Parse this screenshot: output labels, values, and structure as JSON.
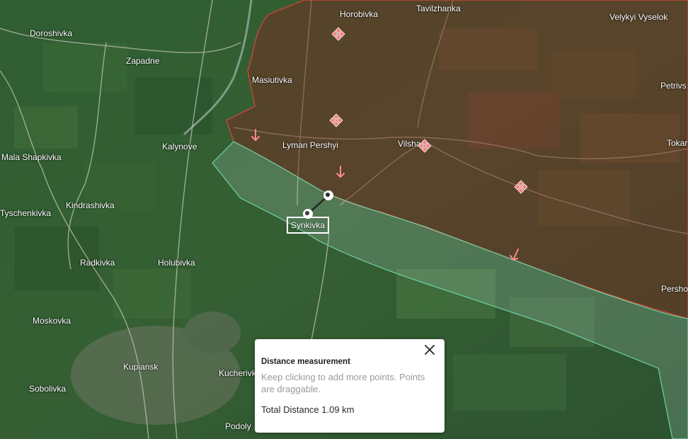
{
  "map": {
    "places": [
      {
        "id": "doroshivka",
        "name": "Doroshivka"
      },
      {
        "id": "zapadne",
        "name": "Zapadne"
      },
      {
        "id": "masiutivka",
        "name": "Masiutivka"
      },
      {
        "id": "horobivka",
        "name": "Horobivka"
      },
      {
        "id": "tavilzhanka",
        "name": "Tavilzhanka"
      },
      {
        "id": "velykyi-vyselok",
        "name": "Velykyi Vyselok"
      },
      {
        "id": "petrivs",
        "name": "Petrivs"
      },
      {
        "id": "kalynove",
        "name": "Kalynove"
      },
      {
        "id": "lyman-pershyi",
        "name": "Lyman Pershyi"
      },
      {
        "id": "vilsha",
        "name": "Vilsha"
      },
      {
        "id": "tokar",
        "name": "Tokar"
      },
      {
        "id": "mala-shapkivka",
        "name": "Mala Shapkivka"
      },
      {
        "id": "kindrashivka",
        "name": "Kindrashivka"
      },
      {
        "id": "tyschenkivka",
        "name": "Tyschenkivka"
      },
      {
        "id": "radkivka",
        "name": "Radkivka"
      },
      {
        "id": "holubivka",
        "name": "Holubivka"
      },
      {
        "id": "persho",
        "name": "Persho"
      },
      {
        "id": "moskovka",
        "name": "Moskovka"
      },
      {
        "id": "kupiansk",
        "name": "Kupiansk"
      },
      {
        "id": "kucherivka",
        "name": "Kucherivk"
      },
      {
        "id": "sobolivka",
        "name": "Sobolivka"
      },
      {
        "id": "podoly",
        "name": "Podoly"
      }
    ],
    "selected_place": "Synkivka",
    "colors": {
      "occupied_fill": "#7a2a22",
      "occupied_border": "#e0453a",
      "contested_fill": "#8fb7a3",
      "contested_border": "#6fd2a4",
      "attack_marker": "#ff7d7d",
      "arrow": "#ff8a8a"
    },
    "icons": {
      "clash_marker": "diamond-cluster-icon",
      "attack_direction": "arrow-down-icon",
      "measure_point": "measure-point-icon"
    }
  },
  "measurement_panel": {
    "title": "Distance measurement",
    "hint": "Keep clicking to add more points. Points are draggable.",
    "total": "Total Distance 1.09 km",
    "close_icon": "close-icon"
  }
}
